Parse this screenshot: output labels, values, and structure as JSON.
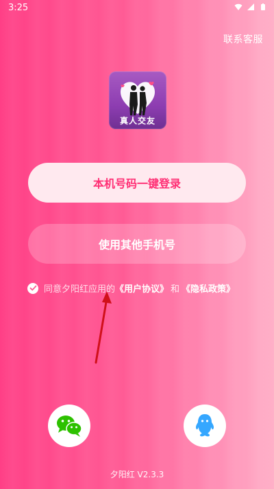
{
  "status_bar": {
    "time": "3:25",
    "icons": [
      "wifi-icon",
      "signal-icon",
      "battery-icon"
    ]
  },
  "header": {
    "contact_label": "联系客服"
  },
  "logo": {
    "text": "真人交友"
  },
  "login": {
    "one_click_label": "本机号码一键登录",
    "other_phone_label": "使用其他手机号"
  },
  "agreement": {
    "prefix": "同意夕阳红应用的",
    "user_agreement": "《用户协议》",
    "and": "和",
    "privacy_policy": "《隐私政策》"
  },
  "social": {
    "wechat_icon": "wechat-icon",
    "qq_icon": "qq-icon"
  },
  "footer": {
    "version": "夕阳红 V2.3.3"
  },
  "colors": {
    "bg_left": "#ff3f86",
    "bg_right": "#ffb0c8",
    "primary_text": "#ff2e74",
    "wechat_green": "#2dc100",
    "qq_blue": "#35a7ff",
    "arrow_red": "#d0101a"
  }
}
